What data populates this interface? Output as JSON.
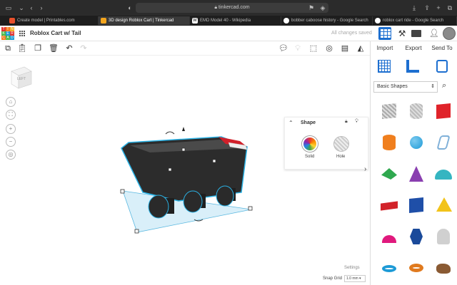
{
  "browser": {
    "url": "tinkercad.com",
    "tabs": [
      {
        "label": "Create model | Printables.com",
        "color": "#e8502b"
      },
      {
        "label": "3D design Roblox Cart | Tinkercad",
        "color": "#f3a51d"
      },
      {
        "label": "EMD Model 40 - Wikipedia",
        "color": "#ffffff"
      },
      {
        "label": "bobber caboose history - Google Search",
        "color": "#ffffff"
      },
      {
        "label": "roblox cart ride - Google Search",
        "color": "#ffffff"
      }
    ]
  },
  "app": {
    "logo_letters": [
      "T",
      "I",
      "N",
      "K",
      "E",
      "R",
      "C",
      "A",
      "D"
    ],
    "design_title": "Roblox Cart w/ Tail",
    "save_status": "All changes saved"
  },
  "right_panel": {
    "actions": [
      "Import",
      "Export",
      "Send To"
    ],
    "category": "Basic Shapes",
    "shapes": [
      {
        "name": "box-hole",
        "color": "#b9b9b9"
      },
      {
        "name": "cylinder-hole",
        "color": "#c4c4c4"
      },
      {
        "name": "box",
        "color": "#e0232a"
      },
      {
        "name": "cylinder",
        "color": "#f07f1e"
      },
      {
        "name": "sphere",
        "color": "#1d9ad6"
      },
      {
        "name": "scribble",
        "color": "#7fb0d8"
      },
      {
        "name": "roof",
        "color": "#2fa84f"
      },
      {
        "name": "cone",
        "color": "#8a3fb0"
      },
      {
        "name": "round-roof",
        "color": "#35b5c1"
      },
      {
        "name": "text",
        "color": "#d2232a"
      },
      {
        "name": "cube",
        "color": "#1f4fa8"
      },
      {
        "name": "pyramid",
        "color": "#f2c31a"
      },
      {
        "name": "half-sphere",
        "color": "#e0197d"
      },
      {
        "name": "polygon",
        "color": "#1a4a9a"
      },
      {
        "name": "paraboloid",
        "color": "#d0d0d0"
      },
      {
        "name": "torus",
        "color": "#1d9ad6"
      },
      {
        "name": "tube",
        "color": "#e07a1e"
      },
      {
        "name": "rock",
        "color": "#8a5a33"
      }
    ]
  },
  "shape_panel": {
    "title": "Shape",
    "solid_label": "Solid",
    "hole_label": "Hole"
  },
  "viewcube": {
    "face": "LEFT"
  },
  "footer": {
    "settings": "Settings",
    "snap_label": "Snap Grid",
    "snap_value": "1.0 mm"
  }
}
